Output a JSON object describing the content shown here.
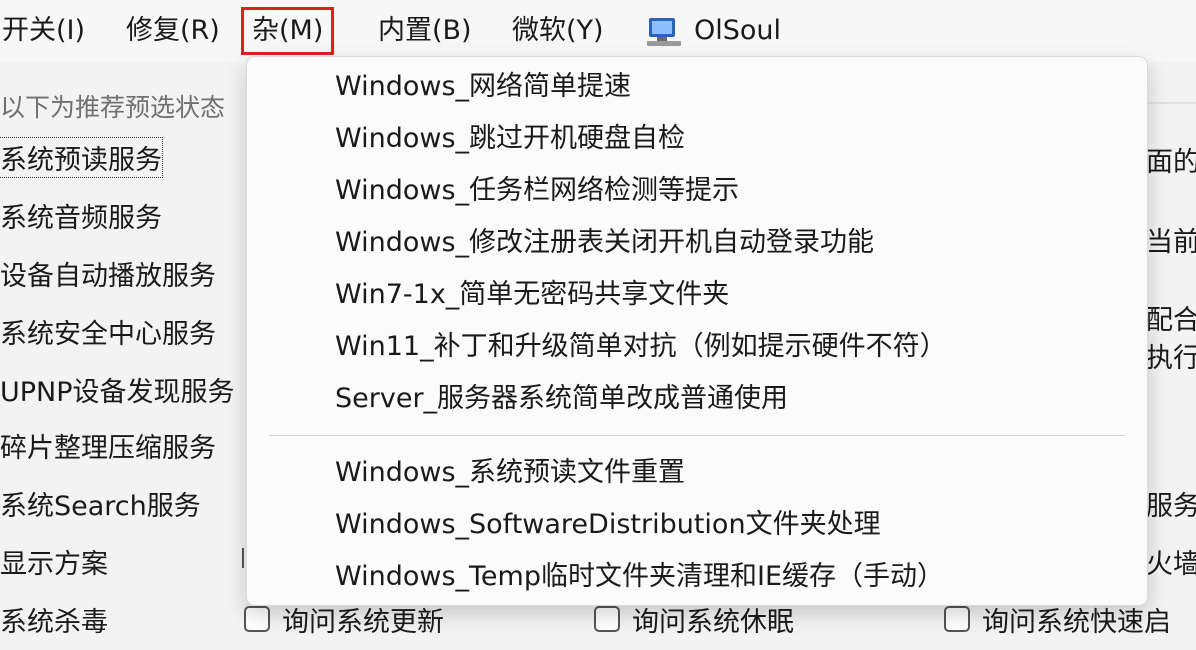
{
  "menubar": {
    "items": [
      {
        "label": "开关(I)"
      },
      {
        "label": "修复(R)"
      },
      {
        "label": "杂(M)"
      },
      {
        "label": "内置(B)"
      },
      {
        "label": "微软(Y)"
      }
    ],
    "app_name": "OlSoul",
    "highlight_color": "#e02020"
  },
  "background": {
    "hint": "以下为推荐预选状态",
    "left_items": [
      "系统预读服务",
      "系统音频服务",
      "设备自动播放服务",
      "系统安全中心服务",
      "UPNP设备发现服务",
      "碎片整理压缩服务",
      "系统Search服务",
      "显示方案",
      "系统杀毒"
    ],
    "right_fragments": [
      "面的",
      "当前",
      "配合",
      "执行",
      "服务",
      "火墙"
    ],
    "bottom_checkboxes": [
      "询问系统更新",
      "询问系统休眠",
      "询问系统快速启"
    ]
  },
  "dropdown": {
    "group1": [
      "Windows_网络简单提速",
      "Windows_跳过开机硬盘自检",
      "Windows_任务栏网络检测等提示",
      "Windows_修改注册表关闭开机自动登录功能",
      "Win7-1x_简单无密码共享文件夹",
      "Win11_补丁和升级简单对抗（例如提示硬件不符）",
      "Server_服务器系统简单改成普通使用"
    ],
    "group2": [
      "Windows_系统预读文件重置",
      "Windows_SoftwareDistribution文件夹处理",
      "Windows_Temp临时文件夹清理和IE缓存（手动）"
    ]
  }
}
